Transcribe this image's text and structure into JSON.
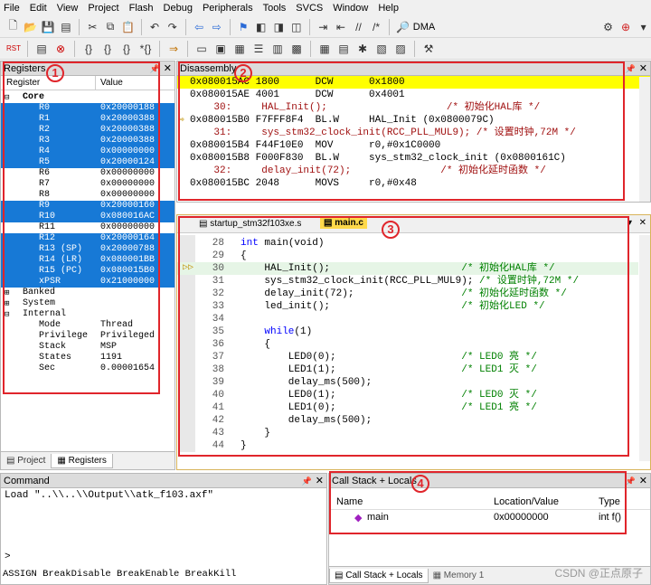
{
  "menu": [
    "File",
    "Edit",
    "View",
    "Project",
    "Flash",
    "Debug",
    "Peripherals",
    "Tools",
    "SVCS",
    "Window",
    "Help"
  ],
  "toolbar": {
    "dma_label": "DMA",
    "rst_label": "RST"
  },
  "registers": {
    "title": "Registers",
    "col_register": "Register",
    "col_value": "Value",
    "core_label": "Core",
    "rows": [
      {
        "name": "R0",
        "value": "0x20000188",
        "sel": true
      },
      {
        "name": "R1",
        "value": "0x20000388",
        "sel": true
      },
      {
        "name": "R2",
        "value": "0x20000388",
        "sel": true
      },
      {
        "name": "R3",
        "value": "0x20000388",
        "sel": true
      },
      {
        "name": "R4",
        "value": "0x00000000",
        "sel": true
      },
      {
        "name": "R5",
        "value": "0x20000124",
        "sel": true
      },
      {
        "name": "R6",
        "value": "0x00000000",
        "sel": false
      },
      {
        "name": "R7",
        "value": "0x00000000",
        "sel": false
      },
      {
        "name": "R8",
        "value": "0x00000000",
        "sel": false
      },
      {
        "name": "R9",
        "value": "0x20000160",
        "sel": true
      },
      {
        "name": "R10",
        "value": "0x080016AC",
        "sel": true
      },
      {
        "name": "R11",
        "value": "0x00000000",
        "sel": false
      },
      {
        "name": "R12",
        "value": "0x20000164",
        "sel": true
      },
      {
        "name": "R13 (SP)",
        "value": "0x20000788",
        "sel": true
      },
      {
        "name": "R14 (LR)",
        "value": "0x080001BB",
        "sel": true
      },
      {
        "name": "R15 (PC)",
        "value": "0x080015B0",
        "sel": true
      },
      {
        "name": "xPSR",
        "value": "0x21000000",
        "sel": true
      }
    ],
    "banked": "Banked",
    "system": "System",
    "internal": "Internal",
    "internal_rows": [
      {
        "name": "Mode",
        "value": "Thread"
      },
      {
        "name": "Privilege",
        "value": "Privileged"
      },
      {
        "name": "Stack",
        "value": "MSP"
      },
      {
        "name": "States",
        "value": "1191"
      },
      {
        "name": "Sec",
        "value": "0.00001654"
      }
    ],
    "tabs": [
      "Project",
      "Registers"
    ]
  },
  "disassembly": {
    "title": "Disassembly",
    "lines": [
      {
        "t": "0x080015AC 1800      DCW      0x1800",
        "style": "hl"
      },
      {
        "t": "0x080015AE 4001      DCW      0x4001",
        "style": ""
      },
      {
        "t": "    30:     HAL_Init();                    /* 初始化HAL库 */",
        "style": "src"
      },
      {
        "t": "0x080015B0 F7FFF8F4  BL.W     HAL_Init (0x0800079C)",
        "style": "cur"
      },
      {
        "t": "    31:     sys_stm32_clock_init(RCC_PLL_MUL9); /* 设置时钟,72M */",
        "style": "src"
      },
      {
        "t": "0x080015B4 F44F10E0  MOV      r0,#0x1C0000",
        "style": ""
      },
      {
        "t": "0x080015B8 F000F830  BL.W     sys_stm32_clock_init (0x0800161C)",
        "style": ""
      },
      {
        "t": "    32:     delay_init(72);               /* 初始化延时函数 */",
        "style": "src"
      },
      {
        "t": "0x080015BC 2048      MOVS     r0,#0x48",
        "style": ""
      }
    ]
  },
  "editor": {
    "tabs": [
      "startup_stm32f103xe.s",
      "main.c"
    ],
    "lines": [
      {
        "n": "28",
        "t": "int main(void)"
      },
      {
        "n": "29",
        "t": "{"
      },
      {
        "n": "30",
        "t": "    HAL_Init();                      /* 初始化HAL库 */"
      },
      {
        "n": "31",
        "t": "    sys_stm32_clock_init(RCC_PLL_MUL9); /* 设置时钟,72M */"
      },
      {
        "n": "32",
        "t": "    delay_init(72);                  /* 初始化延时函数 */"
      },
      {
        "n": "33",
        "t": "    led_init();                      /* 初始化LED */"
      },
      {
        "n": "34",
        "t": ""
      },
      {
        "n": "35",
        "t": "    while(1)"
      },
      {
        "n": "36",
        "t": "    {"
      },
      {
        "n": "37",
        "t": "        LED0(0);                     /* LED0 亮 */"
      },
      {
        "n": "38",
        "t": "        LED1(1);                     /* LED1 灭 */"
      },
      {
        "n": "39",
        "t": "        delay_ms(500);"
      },
      {
        "n": "40",
        "t": "        LED0(1);                     /* LED0 灭 */"
      },
      {
        "n": "41",
        "t": "        LED1(0);                     /* LED1 亮 */"
      },
      {
        "n": "42",
        "t": "        delay_ms(500);"
      },
      {
        "n": "43",
        "t": "    }"
      },
      {
        "n": "44",
        "t": "}"
      }
    ]
  },
  "command": {
    "title": "Command",
    "output": "Load \"..\\\\..\\\\Output\\\\atk_f103.axf\"",
    "prompt": ">",
    "hint": "ASSIGN BreakDisable BreakEnable BreakKill"
  },
  "callstack": {
    "title": "Call Stack + Locals",
    "col_name": "Name",
    "col_loc": "Location/Value",
    "col_type": "Type",
    "row_name": "main",
    "row_loc": "0x00000000",
    "row_type": "int f()",
    "tabs": [
      "Call Stack + Locals",
      "Memory 1"
    ]
  },
  "watermark": "CSDN @正点原子",
  "badges": [
    "1",
    "2",
    "3",
    "4"
  ]
}
